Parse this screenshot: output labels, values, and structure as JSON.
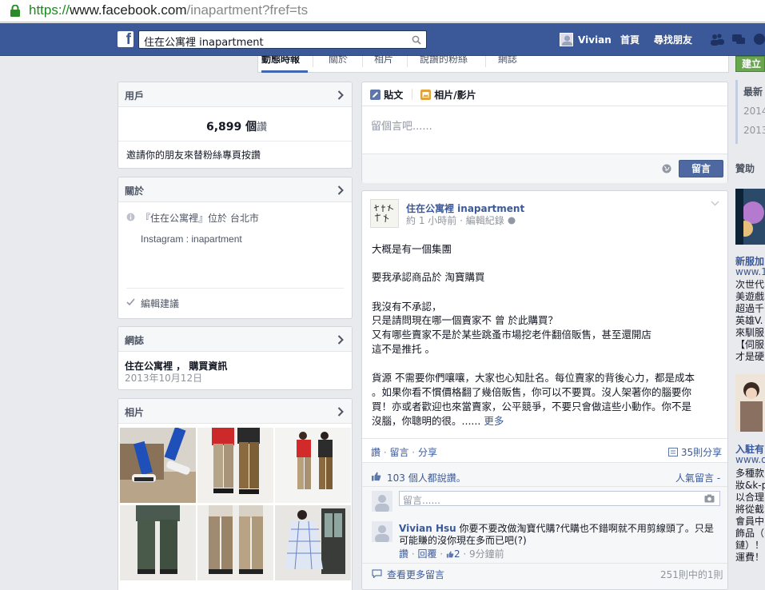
{
  "browser": {
    "url_scheme": "https://",
    "url_host": "www.facebook.com",
    "url_path": "/inapartment?fref=ts"
  },
  "topbar": {
    "logo": "f",
    "search_value": "住在公寓裡 inapartment",
    "user_name": "Vivian",
    "home": "首頁",
    "find_friends": "尋找朋友"
  },
  "tabs": [
    "動態時報",
    "關於",
    "相片",
    "說讚的粉絲",
    "網誌"
  ],
  "like_button": "建立",
  "users_card": {
    "title": "用戶",
    "count": "6,899 個",
    "count_suffix": "讚",
    "invite": "邀請你的朋友來替粉絲專頁按讚"
  },
  "about_card": {
    "title": "關於",
    "location": "『住在公寓裡』位於 台北市",
    "instagram": "Instagram : inapartment",
    "edit": "編輯建議"
  },
  "notes_card": {
    "title": "網誌",
    "note_title": "住在公寓裡 ， 購買資訊",
    "note_date": "2013年10月12日"
  },
  "photos_card": {
    "title": "相片"
  },
  "composer": {
    "tab_post": "貼文",
    "tab_photo": "相片/影片",
    "placeholder": "留個言吧......",
    "submit": "留言"
  },
  "post": {
    "author": "住在公寓裡 inapartment",
    "meta": "約 1 小時前 · 編輯紀錄",
    "lines": [
      "大概是有一個集團",
      "",
      "要我承認商品於 淘寶購買",
      "",
      "我沒有不承認，",
      "只是請問現在哪一個賣家不 曾 於此購買？",
      "又有哪些賣家不是於某些跳蚤市場挖老件翻倍販售，甚至還開店",
      "這不是推托 。",
      "",
      "貨源 不需要你們嚷嚷，大家也心知肚名。每位賣家的背後心力，都是成本",
      "。如果你看不慣價格翻了幾倍販售，你可以不要買。沒人架著你的腦要你",
      "買！亦或者歡迎也來當賣家，公平競爭，不要只會做這些小動作。你不是",
      "沒腦，你聰明的很。......"
    ],
    "more": "更多",
    "action_like": "讚",
    "action_comment": "留言",
    "action_share": "分享",
    "shares": "35則分享",
    "likes": "103 個人都說讚。",
    "sort": "人氣留言 -",
    "comment_placeholder": "留言......",
    "comment_author": "Vivian Hsu",
    "comment_text_1": "你要不要改做淘寶代購?代購也不錯啊就不用剪線頭了。只是",
    "comment_text_2": "可能賺的沒你現在多而已吧(?)",
    "comment_like": "讚",
    "comment_reply": "回覆",
    "comment_count": "2",
    "comment_time": "9分鐘前",
    "view_more": "查看更多留言",
    "comment_total": "251則中的1則"
  },
  "right_column": {
    "recent": "最新",
    "year1": "2014",
    "year2": "2013",
    "sponsored": "贊助",
    "ad1_title": "新服加",
    "ad1_url": "www.1",
    "ad1_lines": [
      "次世代",
      "美遊戲",
      "超過千",
      "英雄V.",
      "來馴服",
      "【伺服",
      "才是硬"
    ],
    "ad2_title": "入駐有",
    "ad2_url": "www.o",
    "ad2_lines": [
      "多種款",
      "妝&k-p",
      "以合理",
      "將從截",
      "會員中",
      "飾品（",
      "鏈）！",
      "運費！"
    ]
  },
  "colors": {
    "fb_blue": "#3b5998",
    "link": "#3b5998",
    "like_green": "#69a74e"
  }
}
